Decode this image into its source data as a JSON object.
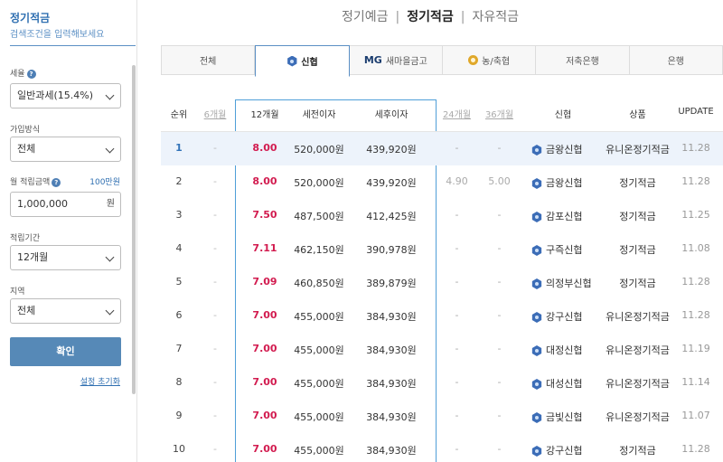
{
  "sidebar": {
    "title": "정기적금",
    "subtitle": "검색조건을 입력해보세요",
    "tax_label": "세율",
    "tax_value": "일반과세(15.4%)",
    "join_label": "가입방식",
    "join_value": "전체",
    "monthly_label": "월 적립금액",
    "monthly_link": "100만원",
    "monthly_value": "1,000,000",
    "monthly_unit": "원",
    "period_label": "적립기간",
    "period_value": "12개월",
    "region_label": "지역",
    "region_value": "전체",
    "confirm_label": "확인",
    "reset_label": "설정 초기화"
  },
  "top_tabs": [
    "정기예금",
    "정기적금",
    "자유적금"
  ],
  "top_tab_active": 1,
  "category_tabs": [
    {
      "label": "전체",
      "icon": ""
    },
    {
      "label": "신협",
      "icon": "shinhyup-logo-icon"
    },
    {
      "label": "새마을금고",
      "icon": "mg-logo-icon",
      "prefix": "MG"
    },
    {
      "label": "농/축협",
      "icon": "nh-logo-icon"
    },
    {
      "label": "저축은행",
      "icon": ""
    },
    {
      "label": "은행",
      "icon": ""
    }
  ],
  "table": {
    "headers": {
      "rank": "순위",
      "m6": "6개월",
      "m12": "12개월",
      "pretax": "세전이자",
      "posttax": "세후이자",
      "m24": "24개월",
      "m36": "36개월",
      "bank": "신협",
      "product": "상품",
      "update": "UPDATE"
    },
    "rows": [
      {
        "rank": "1",
        "m6": "-",
        "m12": "8.00",
        "pretax": "520,000원",
        "posttax": "439,920원",
        "m24": "-",
        "m36": "-",
        "bank": "금왕신협",
        "product": "유니온정기적금",
        "update": "11.28"
      },
      {
        "rank": "2",
        "m6": "-",
        "m12": "8.00",
        "pretax": "520,000원",
        "posttax": "439,920원",
        "m24": "4.90",
        "m36": "5.00",
        "bank": "금왕신협",
        "product": "정기적금",
        "update": "11.28"
      },
      {
        "rank": "3",
        "m6": "-",
        "m12": "7.50",
        "pretax": "487,500원",
        "posttax": "412,425원",
        "m24": "-",
        "m36": "-",
        "bank": "감포신협",
        "product": "정기적금",
        "update": "11.25"
      },
      {
        "rank": "4",
        "m6": "-",
        "m12": "7.11",
        "pretax": "462,150원",
        "posttax": "390,978원",
        "m24": "-",
        "m36": "-",
        "bank": "구즉신협",
        "product": "정기적금",
        "update": "11.08"
      },
      {
        "rank": "5",
        "m6": "-",
        "m12": "7.09",
        "pretax": "460,850원",
        "posttax": "389,879원",
        "m24": "-",
        "m36": "-",
        "bank": "의정부신협",
        "product": "정기적금",
        "update": "11.28"
      },
      {
        "rank": "6",
        "m6": "-",
        "m12": "7.00",
        "pretax": "455,000원",
        "posttax": "384,930원",
        "m24": "-",
        "m36": "-",
        "bank": "강구신협",
        "product": "유니온정기적금",
        "update": "11.28"
      },
      {
        "rank": "7",
        "m6": "-",
        "m12": "7.00",
        "pretax": "455,000원",
        "posttax": "384,930원",
        "m24": "-",
        "m36": "-",
        "bank": "대정신협",
        "product": "유니온정기적금",
        "update": "11.19"
      },
      {
        "rank": "8",
        "m6": "-",
        "m12": "7.00",
        "pretax": "455,000원",
        "posttax": "384,930원",
        "m24": "-",
        "m36": "-",
        "bank": "대성신협",
        "product": "유니온정기적금",
        "update": "11.14"
      },
      {
        "rank": "9",
        "m6": "-",
        "m12": "7.00",
        "pretax": "455,000원",
        "posttax": "384,930원",
        "m24": "-",
        "m36": "-",
        "bank": "금빛신협",
        "product": "유니온정기적금",
        "update": "11.07"
      },
      {
        "rank": "10",
        "m6": "-",
        "m12": "7.00",
        "pretax": "455,000원",
        "posttax": "384,930원",
        "m24": "-",
        "m36": "-",
        "bank": "강구신협",
        "product": "정기적금",
        "update": "11.28"
      }
    ]
  },
  "colors": {
    "accent": "#2f6fb1",
    "rate": "#d21b4f",
    "button": "#5689b7",
    "highlight_border": "#4f9fd8",
    "selected_row": "#edf3fb"
  }
}
